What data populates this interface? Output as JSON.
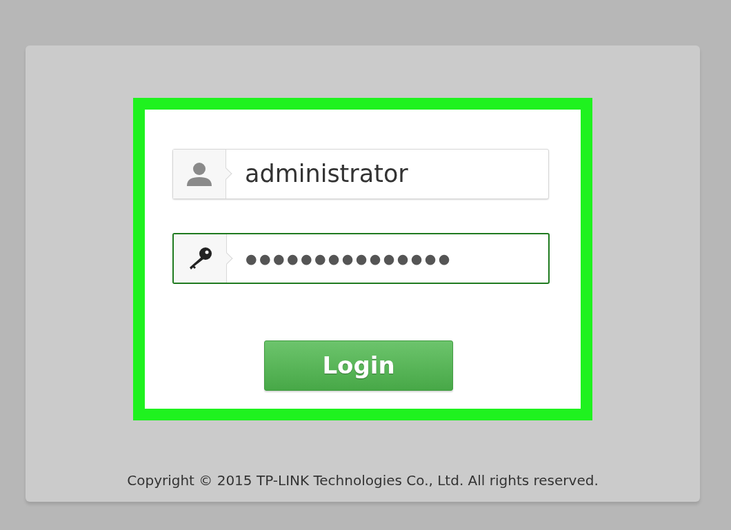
{
  "login_form": {
    "fields": [
      {
        "kind": "username",
        "value": "administrator",
        "focused": false
      },
      {
        "kind": "password",
        "value": "●●●●●●●●●●●●●●●",
        "focused": true
      }
    ],
    "login_button": "Login"
  },
  "footer": {
    "copyright": "Copyright © 2015 TP-LINK Technologies Co., Ltd. All rights reserved."
  }
}
